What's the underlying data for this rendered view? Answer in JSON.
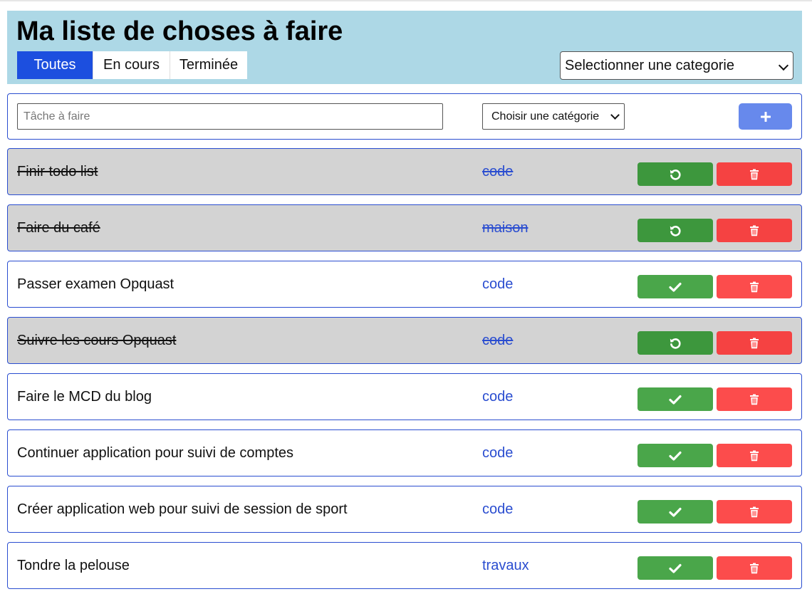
{
  "header": {
    "title": "Ma liste de choses à faire",
    "tabs": [
      {
        "label": "Toutes",
        "active": true
      },
      {
        "label": "En cours",
        "active": false
      },
      {
        "label": "Terminée",
        "active": false
      }
    ],
    "category_filter": {
      "selected": "Selectionner une categorie"
    }
  },
  "add_form": {
    "task_placeholder": "Tâche à faire",
    "category_select": "Choisir une catégorie",
    "add_icon": "plus-icon"
  },
  "tasks": [
    {
      "label": "Finir todo list",
      "category": "code",
      "done": true
    },
    {
      "label": "Faire du café",
      "category": "maison",
      "done": true
    },
    {
      "label": "Passer examen Opquast",
      "category": "code",
      "done": false
    },
    {
      "label": "Suivre les cours Opquast",
      "category": "code",
      "done": true
    },
    {
      "label": "Faire le MCD du blog",
      "category": "code",
      "done": false
    },
    {
      "label": "Continuer application pour suivi de comptes",
      "category": "code",
      "done": false
    },
    {
      "label": "Créer application web pour suivi de session de sport",
      "category": "code",
      "done": false
    },
    {
      "label": "Tondre la pelouse",
      "category": "travaux",
      "done": false
    }
  ],
  "icons": {
    "complete": "check-icon",
    "undo": "undo-icon",
    "delete": "trash-icon"
  },
  "colors": {
    "header_bg": "#add8e6",
    "tab_active": "#1c4fdf",
    "accent": "#2a4dd0",
    "add_button": "#6789ec",
    "complete_button": "#4aa64a",
    "delete_button": "#fc4c4c",
    "done_row_bg": "#d3d3d3"
  }
}
